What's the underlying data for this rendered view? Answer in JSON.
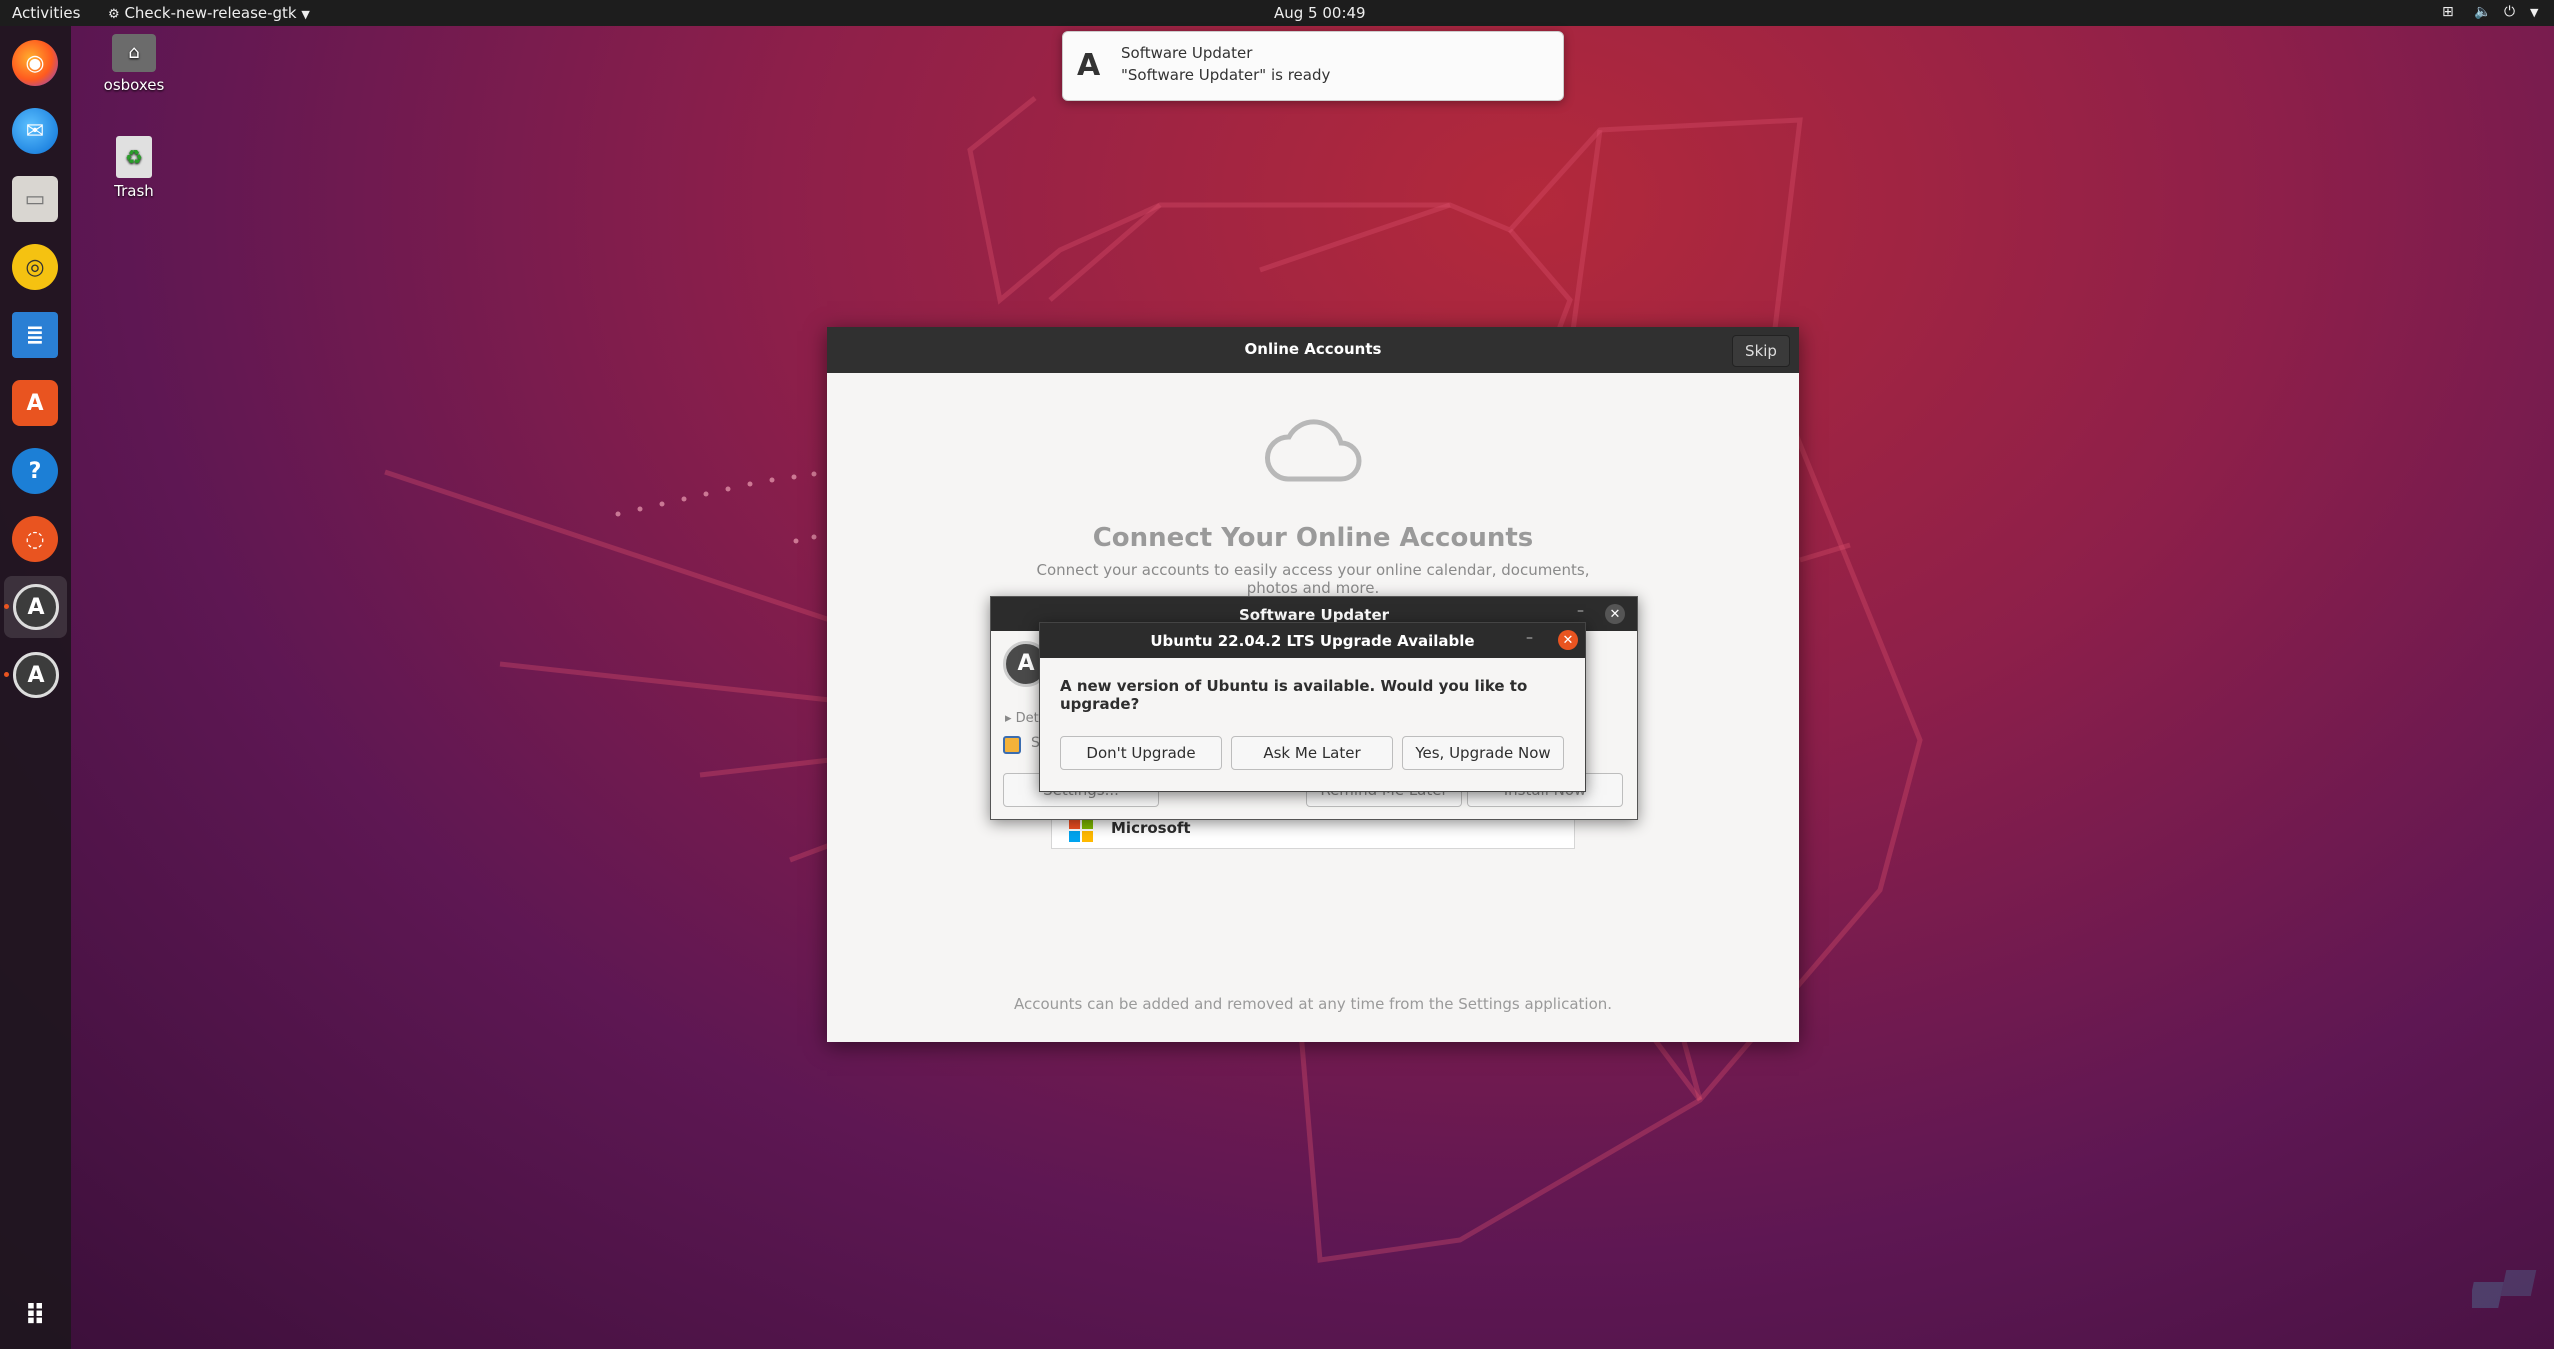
{
  "topbar": {
    "activities": "Activities",
    "app_menu": "Check-new-release-gtk",
    "clock": "Aug 5  00:49"
  },
  "desktop": {
    "icons": [
      {
        "label": "osboxes",
        "icon": "home-folder-icon"
      },
      {
        "label": "Trash",
        "icon": "trash-icon"
      }
    ]
  },
  "dock": {
    "apps": [
      "firefox",
      "thunderbird",
      "files",
      "rhythmbox",
      "libreoffice-writer",
      "ubuntu-software",
      "help",
      "ubuntu",
      "software-updater",
      "software-updater-2",
      "show-applications"
    ]
  },
  "notification": {
    "title": "Software Updater",
    "body": "\"Software Updater\" is ready"
  },
  "online_accounts": {
    "title": "Online Accounts",
    "skip_label": "Skip",
    "heading": "Connect Your Online Accounts",
    "subtitle_line1": "Connect your accounts to easily access your online calendar, documents,",
    "subtitle_line2": "photos and more.",
    "account_microsoft": "Microsoft",
    "footer": "Accounts can be added and removed at any time from the Settings application."
  },
  "software_updater": {
    "title": "Software Updater",
    "details_label": "Det",
    "settings_button": "Settings...",
    "remind_button": "Remind Me Later",
    "install_button": "Install Now",
    "partial_text": "S"
  },
  "upgrade_dialog": {
    "title": "Ubuntu 22.04.2 LTS Upgrade Available",
    "message": "A new version of Ubuntu is available. Would you like to upgrade?",
    "btn_dont": "Don't Upgrade",
    "btn_later": "Ask Me Later",
    "btn_yes": "Yes, Upgrade Now"
  },
  "colors": {
    "accent": "#e95420",
    "titlebar": "#2c2c2c"
  }
}
